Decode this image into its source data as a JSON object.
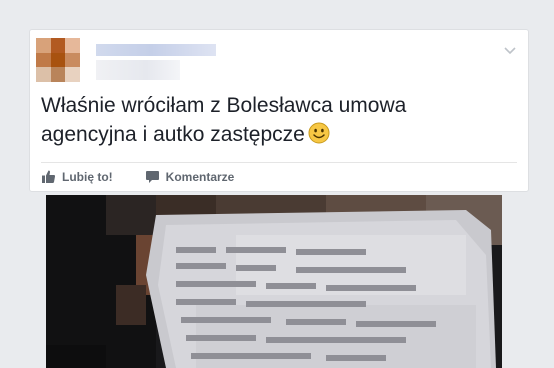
{
  "post": {
    "text_line1": "Właśnie wróciłam z Bolesławca umowa",
    "text_line2": "agencyjna i autko zastępcze",
    "emoji": "smiley-face"
  },
  "actions": {
    "like_label": "Lubię to!",
    "comment_label": "Komentarze"
  },
  "colors": {
    "page_background": "#e9ebee",
    "card_background": "#ffffff",
    "action_text": "#606770",
    "post_text": "#1d2129",
    "emoji_face": "#f7c744"
  }
}
